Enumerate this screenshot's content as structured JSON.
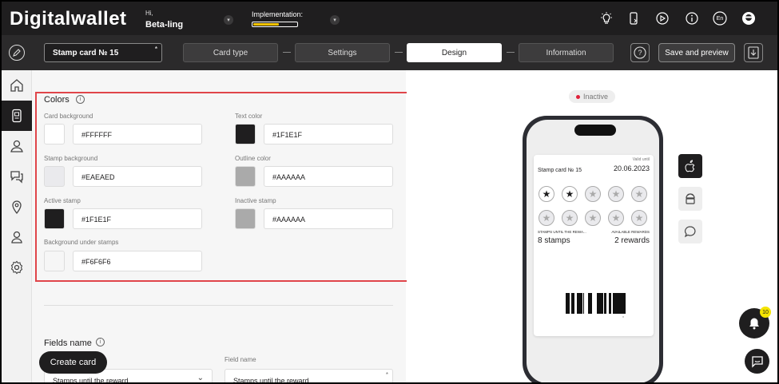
{
  "app": {
    "logo": "Digitalwallet"
  },
  "header": {
    "greeting": "Hi,",
    "user": "Beta-ling",
    "implementation_label": "Implementation:",
    "implementation_progress": 0.6,
    "lang": "En"
  },
  "toolbar": {
    "card_name": "Stamp card № 15",
    "card_name_marker": "*",
    "steps": [
      {
        "label": "Card type"
      },
      {
        "label": "Settings"
      },
      {
        "label": "Design"
      },
      {
        "label": "Information"
      }
    ],
    "active_step": "Design",
    "help": "?",
    "save_label": "Save and preview"
  },
  "colors": {
    "title": "Colors",
    "info": "i",
    "fields": [
      {
        "label": "Card background",
        "value": "#FFFFFF",
        "swatch": "#FFFFFF"
      },
      {
        "label": "Text color",
        "value": "#1F1E1F",
        "swatch": "#1F1E1F"
      },
      {
        "label": "Stamp background",
        "value": "#EAEAED",
        "swatch": "#EAEAED"
      },
      {
        "label": "Outline color",
        "value": "#AAAAAA",
        "swatch": "#AAAAAA"
      },
      {
        "label": "Active stamp",
        "value": "#1F1E1F",
        "swatch": "#1F1E1F"
      },
      {
        "label": "Inactive stamp",
        "value": "#AAAAAA",
        "swatch": "#AAAAAA"
      },
      {
        "label": "Background under stamps",
        "value": "#F6F6F6",
        "swatch": "#F6F6F6"
      }
    ]
  },
  "fields_name": {
    "title": "Fields name",
    "info": "i",
    "field_name_label": "Field name",
    "select_value": "Stamps until the reward",
    "field_value": "Stamps until the reward",
    "field_marker": "*"
  },
  "create_card": "Create card",
  "preview": {
    "status": "Inactive",
    "card_title": "Stamp card № 15",
    "valid_until_label": "Valid until",
    "valid_until": "20.06.2023",
    "stamps_active": 2,
    "stamps_total": 10,
    "left_label": "STAMPS UNTIL THE REWA...",
    "left_value": "8 stamps",
    "right_label": "AVAILABLE REWARDS",
    "right_value": "2 rewards",
    "barcode_caption": "*"
  },
  "notifications": {
    "count": "10"
  },
  "accent_colors": {
    "highlight_border": "#e0454a",
    "progress": "#f5c400",
    "inactive_dot": "#e0213a",
    "badge": "#f5e400"
  }
}
